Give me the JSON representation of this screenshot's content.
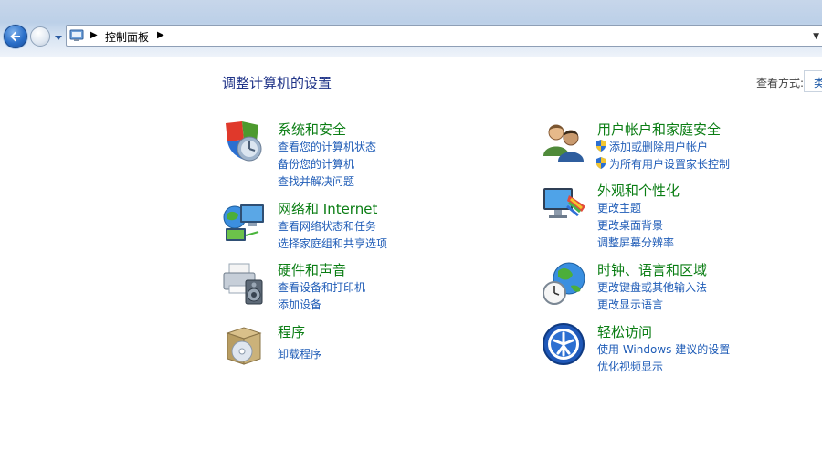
{
  "address": {
    "crumb": "控制面板"
  },
  "page": {
    "title": "调整计算机的设置",
    "viewby_label": "查看方式:",
    "viewby_value": "类"
  },
  "categories": [
    {
      "title": "系统和安全",
      "icon": "security-shield-icon",
      "links": [
        "查看您的计算机状态",
        "备份您的计算机",
        "查找并解决问题"
      ]
    },
    {
      "title": "网络和 Internet",
      "icon": "network-globe-icon",
      "links": [
        "查看网络状态和任务",
        "选择家庭组和共享选项"
      ]
    },
    {
      "title": "硬件和声音",
      "icon": "printer-speaker-icon",
      "links": [
        "查看设备和打印机",
        "添加设备"
      ]
    },
    {
      "title": "程序",
      "icon": "programs-box-icon",
      "links": [
        "卸载程序"
      ]
    },
    {
      "title": "用户帐户和家庭安全",
      "icon": "users-icon",
      "links": [
        "添加或删除用户帐户",
        "为所有用户设置家长控制"
      ]
    },
    {
      "title": "外观和个性化",
      "icon": "display-palette-icon",
      "links": [
        "更改主题",
        "更改桌面背景",
        "调整屏幕分辨率"
      ]
    },
    {
      "title": "时钟、语言和区域",
      "icon": "clock-globe-icon",
      "links": [
        "更改键盘或其他输入法",
        "更改显示语言"
      ]
    },
    {
      "title": "轻松访问",
      "icon": "ease-of-access-icon",
      "links": [
        "使用 Windows 建议的设置",
        "优化视频显示"
      ]
    }
  ]
}
